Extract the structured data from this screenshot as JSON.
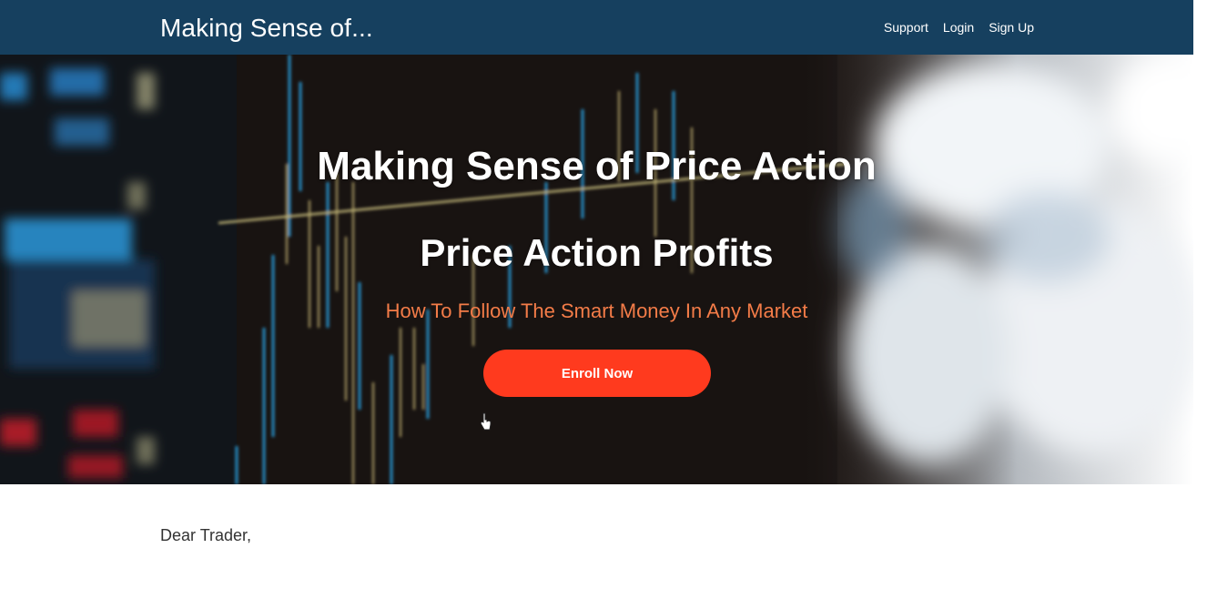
{
  "navbar": {
    "brand": "Making Sense of...",
    "links": [
      {
        "label": "Support"
      },
      {
        "label": "Login"
      },
      {
        "label": "Sign Up"
      }
    ]
  },
  "hero": {
    "title": "Making Sense of Price Action",
    "subtitle": "Price Action Profits",
    "tagline": "How To Follow The Smart Money In Any Market",
    "cta_label": "Enroll Now"
  },
  "content": {
    "greeting": "Dear Trader,"
  },
  "colors": {
    "navbar": "#16405f",
    "tagline": "#f47c48",
    "cta": "#ff3a1e"
  }
}
